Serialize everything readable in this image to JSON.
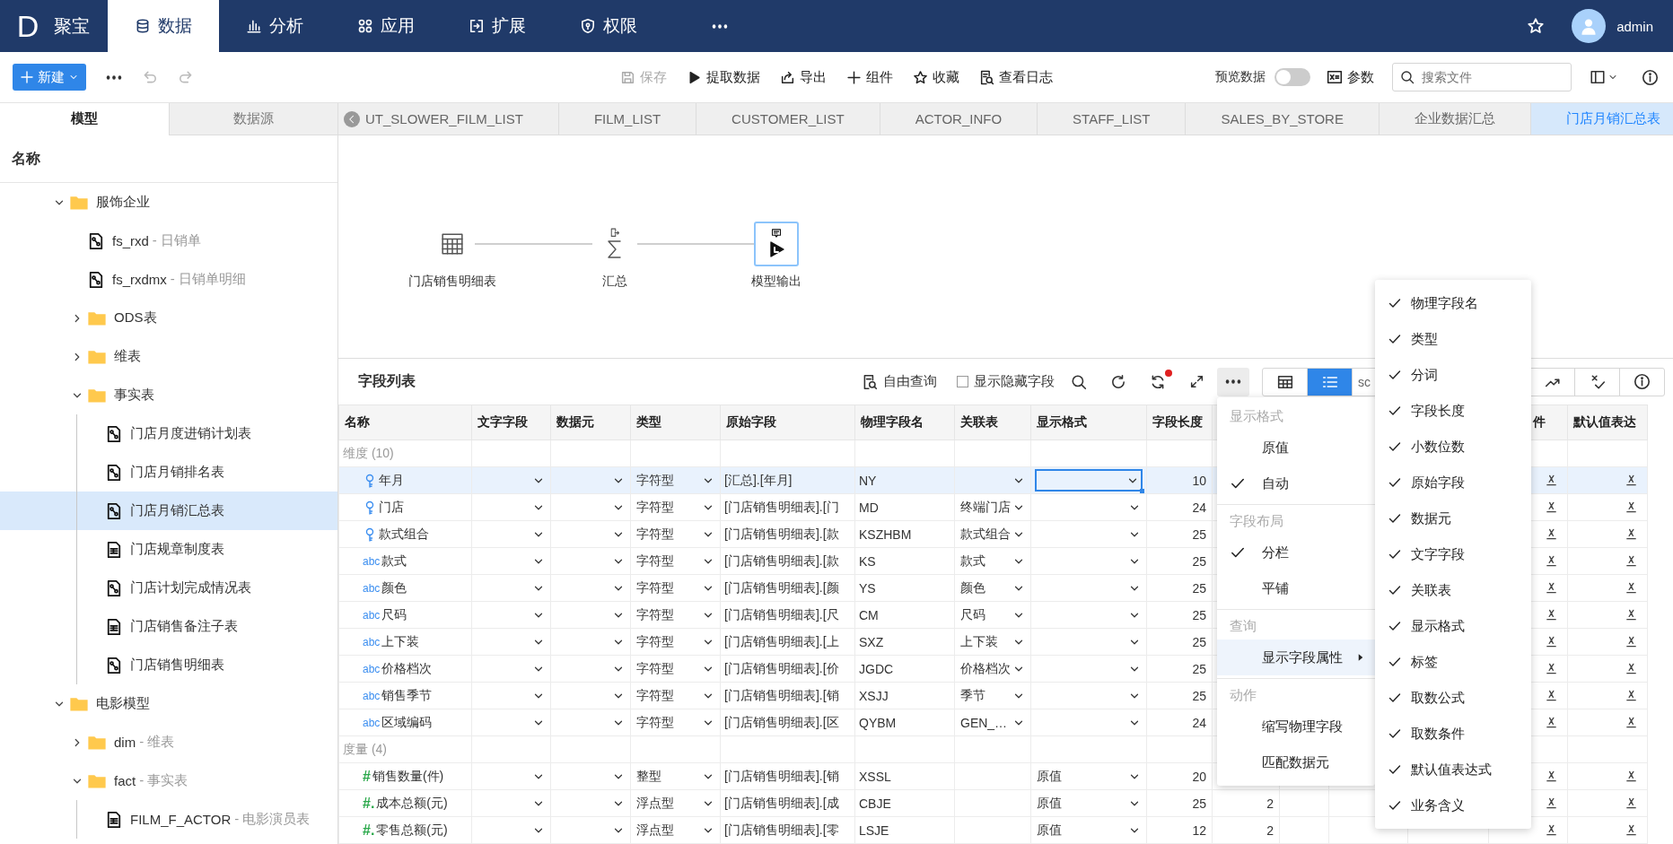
{
  "app": {
    "logo": "D",
    "name": "聚宝"
  },
  "nav": [
    {
      "label": "数据",
      "selected": true
    },
    {
      "label": "分析",
      "selected": false
    },
    {
      "label": "应用",
      "selected": false
    },
    {
      "label": "扩展",
      "selected": false
    },
    {
      "label": "权限",
      "selected": false
    },
    {
      "selected": false
    }
  ],
  "user": {
    "name": "admin"
  },
  "toolbar": {
    "new_button": "新建",
    "actions": [
      {
        "label": "保存",
        "disabled": true
      },
      {
        "label": "提取数据",
        "disabled": false
      },
      {
        "label": "导出",
        "disabled": false
      },
      {
        "label": "组件",
        "disabled": false
      },
      {
        "label": "收藏",
        "disabled": false
      },
      {
        "label": "查看日志",
        "disabled": false
      }
    ],
    "preview": {
      "label": "预览数据",
      "on": false
    },
    "params": "参数",
    "search": {
      "placeholder": "搜索文件"
    }
  },
  "sidebar": {
    "tabs": [
      {
        "label": "模型",
        "selected": true
      },
      {
        "label": "数据源",
        "selected": false
      }
    ],
    "header": "名称",
    "tree": [
      {
        "label": "服饰企业",
        "kind": "folder",
        "expanded": true,
        "selected": false,
        "children": [
          {
            "label": "fs_rxd",
            "note": "- 日销单",
            "kind": "model",
            "selected": false
          },
          {
            "label": "fs_rxdmx",
            "note": "- 日销单明细",
            "kind": "model",
            "selected": false
          },
          {
            "label": "ODS表",
            "kind": "folder",
            "expanded": false,
            "selected": false
          },
          {
            "label": "维表",
            "kind": "folder",
            "expanded": false,
            "selected": false
          },
          {
            "label": "事实表",
            "kind": "folder",
            "expanded": true,
            "selected": false,
            "children": [
              {
                "label": "门店月度进销计划表",
                "kind": "model",
                "selected": false
              },
              {
                "label": "门店月销排名表",
                "kind": "model",
                "selected": false
              },
              {
                "label": "门店月销汇总表",
                "kind": "model",
                "selected": true
              },
              {
                "label": "门店规章制度表",
                "kind": "table",
                "selected": false
              },
              {
                "label": "门店计划完成情况表",
                "kind": "model",
                "selected": false
              },
              {
                "label": "门店销售备注子表",
                "kind": "table",
                "selected": false
              },
              {
                "label": "门店销售明细表",
                "kind": "model",
                "selected": false
              }
            ]
          }
        ]
      },
      {
        "label": "电影模型",
        "kind": "folder",
        "expanded": true,
        "selected": false,
        "children": [
          {
            "label": "dim",
            "note": "- 维表",
            "kind": "folder",
            "expanded": false,
            "selected": false
          },
          {
            "label": "fact",
            "note": "- 事实表",
            "kind": "folder",
            "expanded": true,
            "selected": false,
            "children": [
              {
                "label": "FILM_F_ACTOR",
                "note": "- 电影演员表",
                "kind": "table",
                "selected": false
              }
            ]
          }
        ]
      }
    ]
  },
  "doc_tabs": [
    {
      "label": "UT_SLOWER_FILM_LIST",
      "selected": false
    },
    {
      "label": "FILM_LIST",
      "selected": false
    },
    {
      "label": "CUSTOMER_LIST",
      "selected": false
    },
    {
      "label": "ACTOR_INFO",
      "selected": false
    },
    {
      "label": "STAFF_LIST",
      "selected": false
    },
    {
      "label": "SALES_BY_STORE",
      "selected": false
    },
    {
      "label": "企业数据汇总",
      "selected": false
    },
    {
      "label": "门店月销汇总表",
      "selected": true
    }
  ],
  "flow": [
    {
      "label": "门店销售明细表",
      "kind": "table",
      "selected": false
    },
    {
      "label": "汇总",
      "kind": "sum",
      "selected": false
    },
    {
      "label": "模型输出",
      "kind": "output",
      "selected": true
    }
  ],
  "field_list": {
    "title": "字段列表",
    "free_query": "自由查询",
    "show_hidden": {
      "label": "显示隐藏字段",
      "checked": false
    },
    "more_expanded": true,
    "views": [
      {
        "kind": "table",
        "selected": false
      },
      {
        "kind": "list",
        "selected": true
      },
      {
        "kind": "text",
        "label": "sc",
        "selected": false
      }
    ]
  },
  "table": {
    "columns": [
      "名称",
      "文字字段",
      "数据元",
      "类型",
      "原始字段",
      "物理字段名",
      "关联表",
      "显示格式",
      "字段长度",
      "件",
      "默认值表达"
    ],
    "groups": [
      {
        "label": "维度 (10)",
        "rows": [
          {
            "kind": "key",
            "name": "年月",
            "type": "字符型",
            "source": "[汇总].[年月]",
            "physical": "NY",
            "length": "10",
            "selected": true,
            "format_focused": true
          },
          {
            "kind": "key",
            "name": "门店",
            "type": "字符型",
            "source": "[门店销售明细表].[门",
            "physical": "MD",
            "relation": "终端门店",
            "length": "24",
            "selected": false,
            "format_focused": false
          },
          {
            "kind": "key",
            "name": "款式组合",
            "type": "字符型",
            "source": "[门店销售明细表].[款",
            "physical": "KSZHBM",
            "relation": "款式组合",
            "length": "25",
            "selected": false,
            "format_focused": false
          },
          {
            "kind": "text",
            "badge": "abc",
            "name": "款式",
            "type": "字符型",
            "source": "[门店销售明细表].[款",
            "physical": "KS",
            "relation": "款式",
            "length": "25",
            "selected": false,
            "format_focused": false
          },
          {
            "kind": "text",
            "badge": "abc",
            "name": "颜色",
            "type": "字符型",
            "source": "[门店销售明细表].[颜",
            "physical": "YS",
            "relation": "颜色",
            "length": "25",
            "selected": false,
            "format_focused": false
          },
          {
            "kind": "text",
            "badge": "abc",
            "name": "尺码",
            "type": "字符型",
            "source": "[门店销售明细表].[尺",
            "physical": "CM",
            "relation": "尺码",
            "length": "25",
            "selected": false,
            "format_focused": false
          },
          {
            "kind": "text",
            "badge": "abc",
            "name": "上下装",
            "type": "字符型",
            "source": "[门店销售明细表].[上",
            "physical": "SXZ",
            "relation": "上下装",
            "length": "25",
            "selected": false,
            "format_focused": false
          },
          {
            "kind": "text",
            "badge": "abc",
            "name": "价格档次",
            "type": "字符型",
            "source": "[门店销售明细表].[价",
            "physical": "JGDC",
            "relation": "价格档次",
            "length": "25",
            "selected": false,
            "format_focused": false
          },
          {
            "kind": "text",
            "badge": "abc",
            "name": "销售季节",
            "type": "字符型",
            "source": "[门店销售明细表].[销",
            "physical": "XSJJ",
            "relation": "季节",
            "length": "25",
            "selected": false,
            "format_focused": false
          },
          {
            "kind": "text",
            "badge": "abc",
            "name": "区域编码",
            "type": "字符型",
            "source": "[门店销售明细表].[区",
            "physical": "QYBM",
            "relation": "GEN_…",
            "length": "24",
            "selected": false,
            "format_focused": false
          }
        ]
      },
      {
        "label": "度量 (4)",
        "rows": [
          {
            "kind": "number",
            "badge": "#",
            "name": "销售数量(件)",
            "type": "整型",
            "source": "[门店销售明细表].[销",
            "physical": "XSSL",
            "format": "原值",
            "length": "20",
            "selected": false,
            "format_focused": false
          },
          {
            "kind": "number",
            "badge": "#.",
            "name": "成本总额(元)",
            "type": "浮点型",
            "source": "[门店销售明细表].[成",
            "physical": "CBJE",
            "format": "原值",
            "length": "25",
            "decimals": "2",
            "selected": false,
            "format_focused": false
          },
          {
            "kind": "number",
            "badge": "#.",
            "name": "零售总额(元)",
            "type": "浮点型",
            "source": "[门店销售明细表].[零",
            "physical": "LSJE",
            "format": "原值",
            "length": "12",
            "decimals": "2",
            "selected": false,
            "format_focused": false
          }
        ]
      }
    ]
  },
  "more_menu": {
    "sections": [
      {
        "title": "显示格式",
        "items": [
          {
            "label": "原值",
            "checked": false,
            "selected": false,
            "submenu": false
          },
          {
            "label": "自动",
            "checked": true,
            "selected": false,
            "submenu": false
          }
        ]
      },
      {
        "title": "字段布局",
        "items": [
          {
            "label": "分栏",
            "checked": true,
            "selected": false,
            "submenu": false
          },
          {
            "label": "平铺",
            "checked": false,
            "selected": false,
            "submenu": false
          }
        ]
      },
      {
        "title": "查询",
        "items": [
          {
            "label": "显示字段属性",
            "checked": false,
            "selected": true,
            "submenu": true
          }
        ]
      },
      {
        "title": "动作",
        "items": [
          {
            "label": "缩写物理字段",
            "checked": false,
            "selected": false,
            "submenu": false
          },
          {
            "label": "匹配数据元",
            "checked": false,
            "selected": false,
            "submenu": false
          }
        ]
      }
    ]
  },
  "field_menu": [
    {
      "label": "物理字段名",
      "checked": true
    },
    {
      "label": "类型",
      "checked": true
    },
    {
      "label": "分词",
      "checked": true
    },
    {
      "label": "字段长度",
      "checked": true
    },
    {
      "label": "小数位数",
      "checked": true
    },
    {
      "label": "原始字段",
      "checked": true
    },
    {
      "label": "数据元",
      "checked": true
    },
    {
      "label": "文字字段",
      "checked": true
    },
    {
      "label": "关联表",
      "checked": true
    },
    {
      "label": "显示格式",
      "checked": true
    },
    {
      "label": "标签",
      "checked": true
    },
    {
      "label": "取数公式",
      "checked": true
    },
    {
      "label": "取数条件",
      "checked": true
    },
    {
      "label": "默认值表达式",
      "checked": true
    },
    {
      "label": "业务含义",
      "checked": true
    }
  ]
}
